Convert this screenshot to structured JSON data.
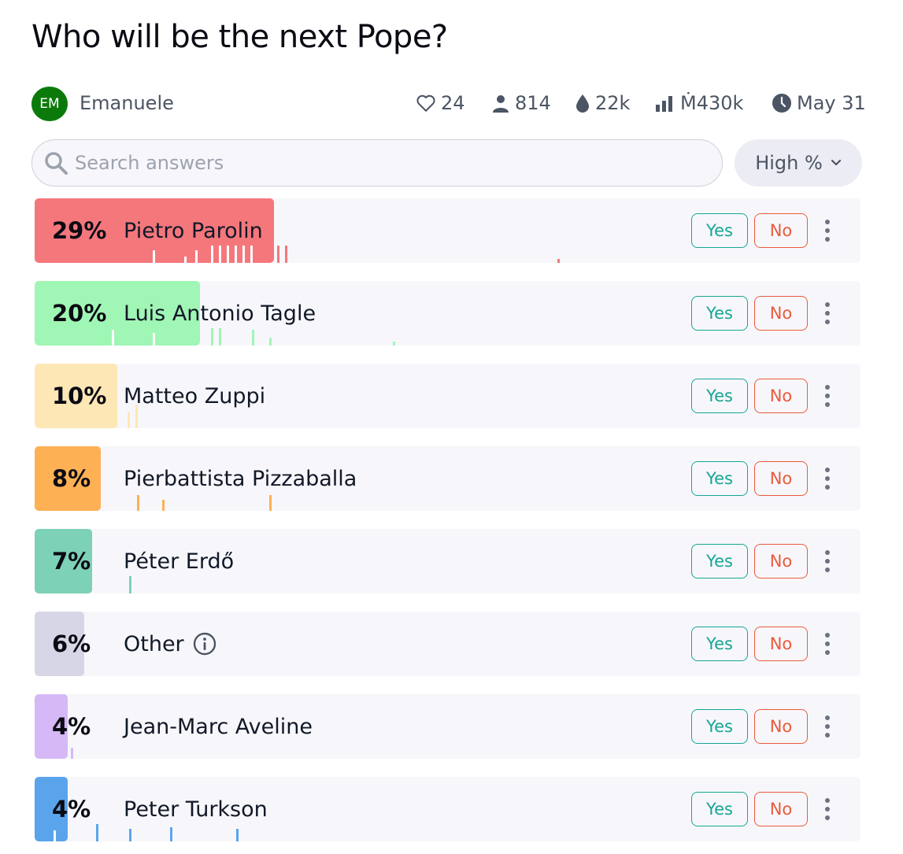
{
  "question": "Who will be the next Pope?",
  "creator": {
    "initials": "EM",
    "name": "Emanuele",
    "avatar_color": "#0b7a0b"
  },
  "stats": {
    "likes": "24",
    "traders": "814",
    "liquidity": "22k",
    "volume": "Ṁ430k",
    "close_date": "May 31"
  },
  "stat_icons": [
    "heart-icon",
    "person-icon",
    "droplet-icon",
    "bar-chart-icon",
    "clock-icon"
  ],
  "search": {
    "placeholder": "Search answers",
    "value": ""
  },
  "sort": {
    "label": "High %"
  },
  "buttons": {
    "yes": "Yes",
    "no": "No"
  },
  "colors": {
    "yes": "#16a594",
    "no": "#ea5a3c",
    "row_bg": "#f7f7fb"
  },
  "answers": [
    {
      "prob": 29,
      "label": "29%",
      "name": "Pietro Parolin",
      "color": "#f4777c",
      "has_info": false
    },
    {
      "prob": 20,
      "label": "20%",
      "name": "Luis Antonio Tagle",
      "color": "#a0f6b4",
      "has_info": false
    },
    {
      "prob": 10,
      "label": "10%",
      "name": "Matteo Zuppi",
      "color": "#fde7b5",
      "has_info": false
    },
    {
      "prob": 8,
      "label": "8%",
      "name": "Pierbattista Pizzaballa",
      "color": "#feb054",
      "has_info": false
    },
    {
      "prob": 7,
      "label": "7%",
      "name": "Péter Erdő",
      "color": "#7dd1b6",
      "has_info": false
    },
    {
      "prob": 6,
      "label": "6%",
      "name": "Other",
      "color": "#d6d6e6",
      "has_info": true
    },
    {
      "prob": 4,
      "label": "4%",
      "name": "Jean-Marc Aveline",
      "color": "#d6b8f6",
      "has_info": false
    },
    {
      "prob": 4,
      "label": "4%",
      "name": "Peter Turkson",
      "color": "#5aa4ec",
      "has_info": false
    }
  ]
}
